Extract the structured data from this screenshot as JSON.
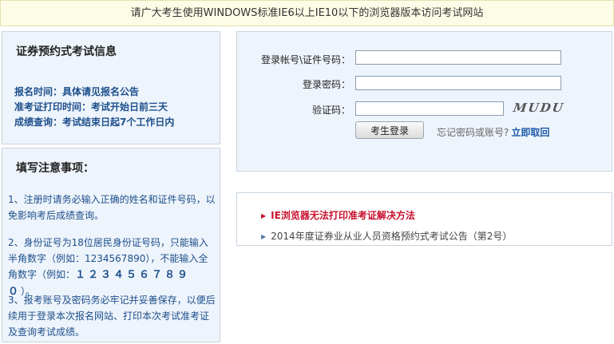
{
  "banner": {
    "text": "请广大考生使用WINDOWS标准IE6以上IE10以下的浏览器版本访问考试网站"
  },
  "exam_info": {
    "title": "证券预约式考试信息",
    "lines": [
      "报名时间：具体请见报名公告",
      "准考证打印时间：考试开始日前三天",
      "成绩查询：考试结束日起7个工作日内"
    ]
  },
  "notes": {
    "title": "填写注意事项：",
    "item1": "1、注册时请务必输入正确的姓名和证件号码，以免影响考后成绩查询。",
    "item2_text": "2、身份证号为18位居民身份证号码，只能输入半角数字（例如：1234567890），不能输入全角数字（例如：",
    "item2_digits": "１２３４５６７８９０",
    "item2_end": "）。",
    "item3": "3、报考账号及密码务必牢记并妥善保存，以便后续用于登录本次报名网站、打印本次考试准考证及查询考试成绩。"
  },
  "login": {
    "account_label": "登录帐号\\证件号码：",
    "password_label": "登录密码：",
    "captcha_label": "验证码：",
    "account_value": "",
    "password_value": "",
    "captcha_value": "",
    "captcha_text": "MUDU",
    "submit_label": "考生登录",
    "forgot_text": "忘记密码或账号?",
    "retrieve_link": "立即取回"
  },
  "notices": [
    {
      "text": "IE浏览器无法打印准考证解决方法"
    },
    {
      "text": "2014年度证券业从业人员资格预约式考试公告（第2号）"
    }
  ]
}
